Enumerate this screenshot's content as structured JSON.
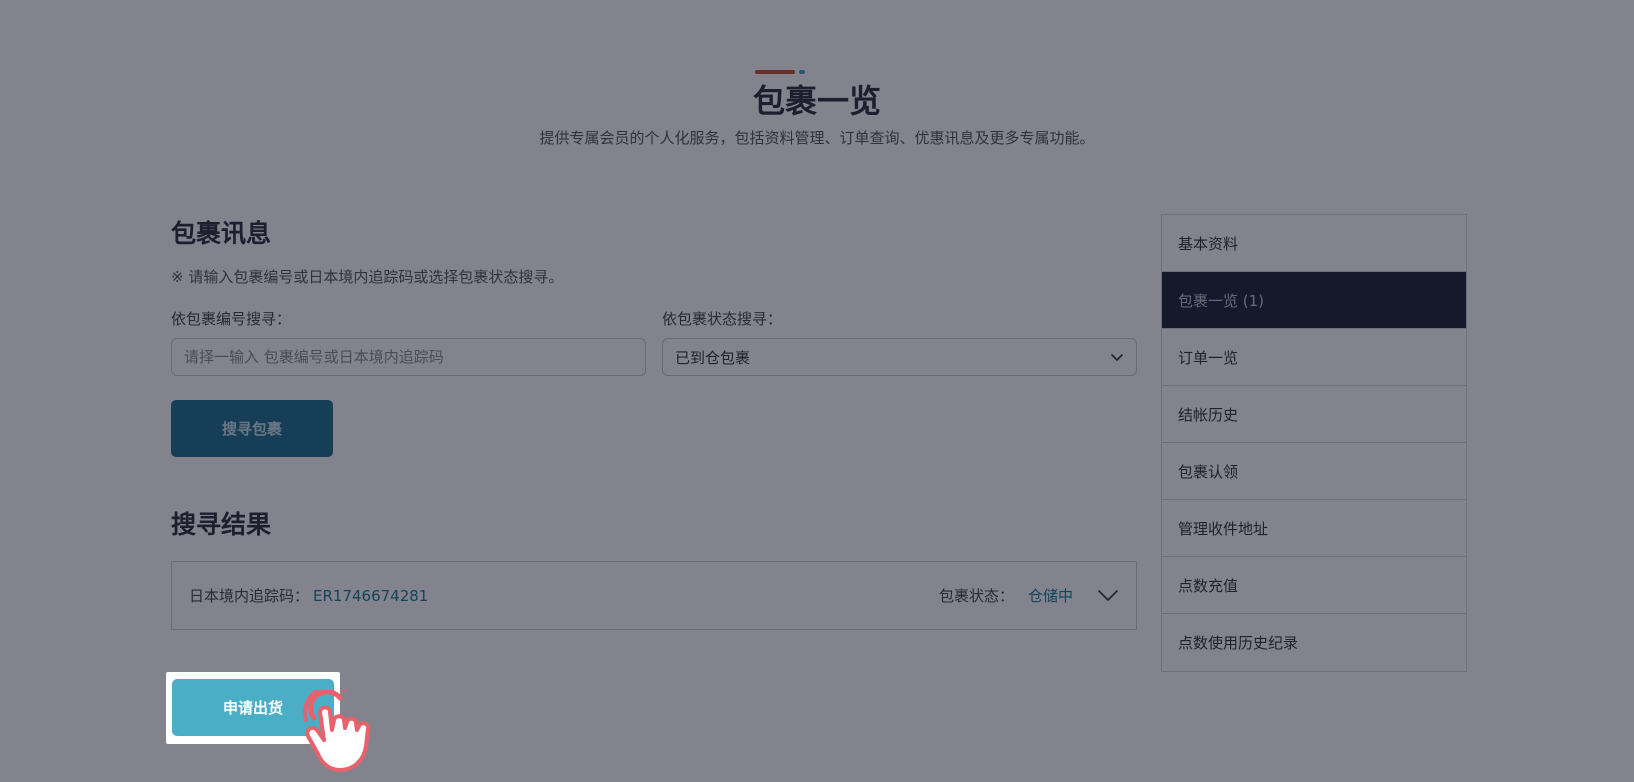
{
  "header": {
    "title": "包裹一览",
    "subtitle": "提供专属会员的个人化服务，包括资料管理、订单查询、优惠讯息及更多专属功能。"
  },
  "package_info": {
    "title": "包裹讯息",
    "note": "※ 请输入包裹编号或日本境内追踪码或选择包裹状态搜寻。",
    "by_number_label": "依包裹编号搜寻：",
    "by_number_placeholder": "请择一输入 包裹编号或日本境内追踪码",
    "by_status_label": "依包裹状态搜寻：",
    "by_status_value": "已到仓包裹",
    "search_button": "搜寻包裹"
  },
  "results": {
    "title": "搜寻结果",
    "rows": [
      {
        "tracking_label": "日本境内追踪码：",
        "tracking_code": "ER1746674281",
        "status_label": "包裹状态：",
        "status_value": "仓储中"
      }
    ]
  },
  "actions": {
    "ship_button": "申请出货"
  },
  "sidebar": {
    "items": [
      {
        "label": "基本资料",
        "active": false
      },
      {
        "label": "包裹一览 (1)",
        "active": true
      },
      {
        "label": "订单一览",
        "active": false
      },
      {
        "label": "结帐历史",
        "active": false
      },
      {
        "label": "包裹认领",
        "active": false
      },
      {
        "label": "管理收件地址",
        "active": false
      },
      {
        "label": "点数充值",
        "active": false
      },
      {
        "label": "点数使用历史纪录",
        "active": false
      }
    ]
  },
  "colors": {
    "accent_orange": "#c0512f",
    "accent_teal": "#3ea6bd",
    "primary_button": "#49aec6",
    "hand_outline": "#e8616b"
  },
  "icons": {
    "select_arrow": "chevron-down-icon",
    "expand_row": "chevron-down-icon",
    "pointer": "hand-pointer-icon"
  }
}
